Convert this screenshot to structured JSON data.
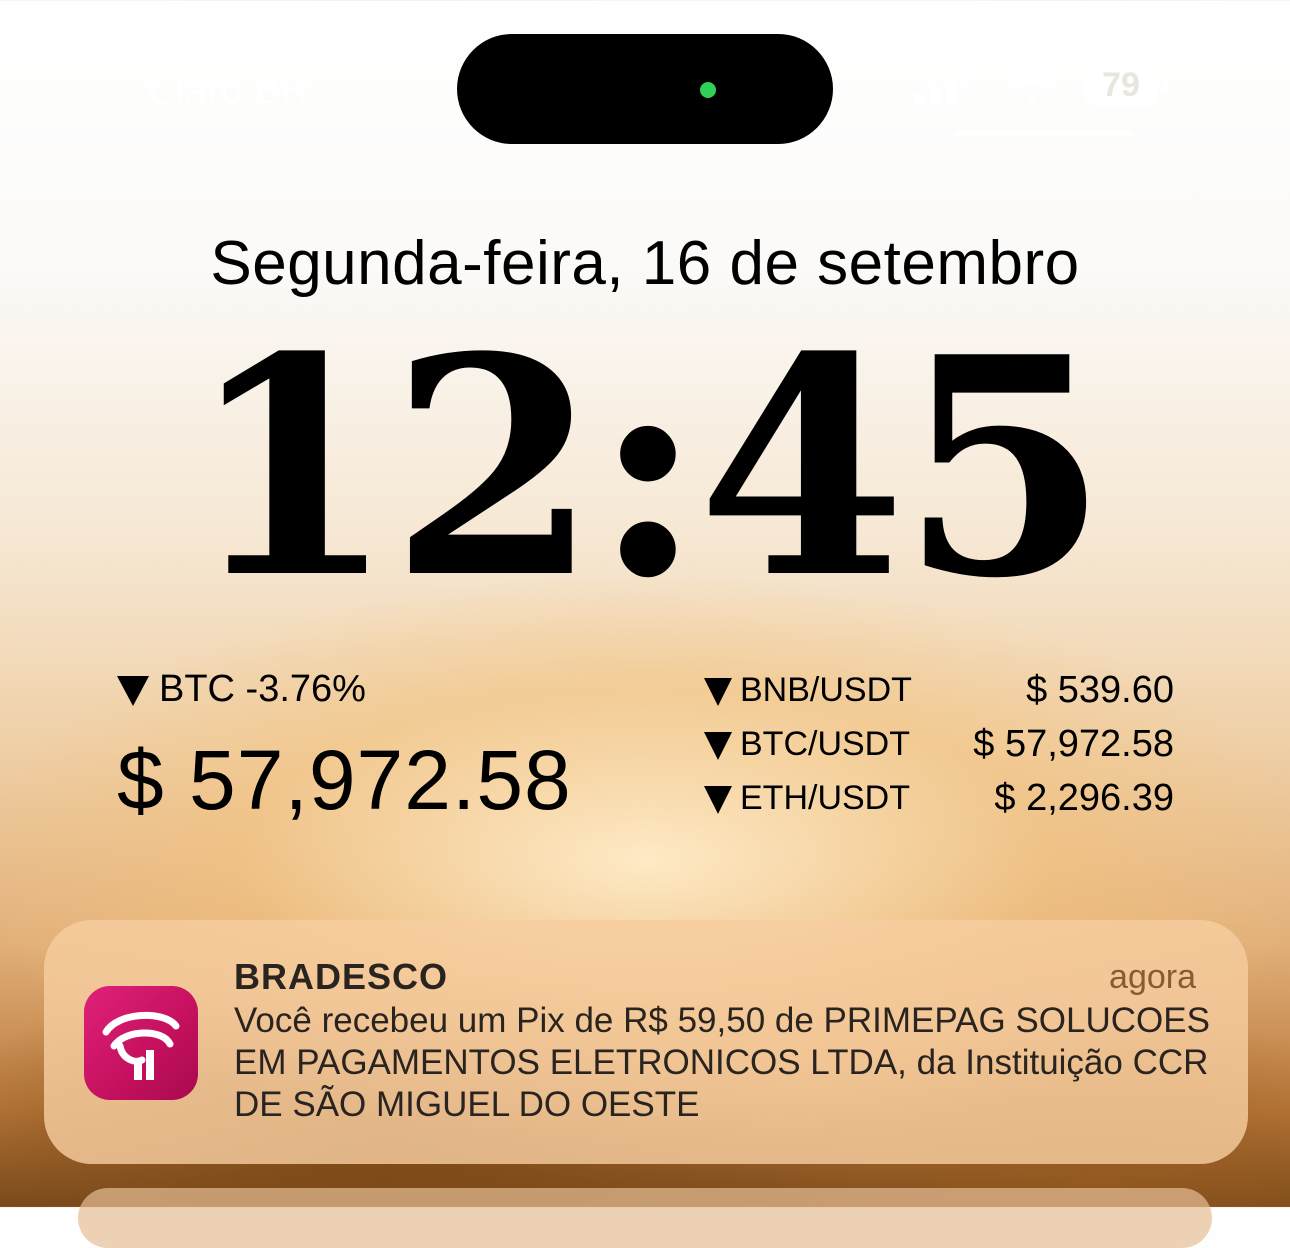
{
  "status_bar": {
    "carrier": "Claro BR",
    "battery_level": "79",
    "island_indicator_color": "#30d158"
  },
  "lock_screen": {
    "date": "Segunda-feira, 16 de setembro",
    "time": "12:45"
  },
  "btc_widget": {
    "direction_icon": "triangle-down-icon",
    "change_label": "BTC -3.76%",
    "price": "$ 57,972.58"
  },
  "pairs_widget": {
    "rows": [
      {
        "name": "BNB/USDT",
        "price": "$ 539.60"
      },
      {
        "name": "BTC/USDT",
        "price": "$ 57,972.58"
      },
      {
        "name": "ETH/USDT",
        "price": "$ 2,296.39"
      }
    ]
  },
  "notification": {
    "app_name": "BRADESCO",
    "time": "agora",
    "body": "Você recebeu um Pix de R$ 59,50 de PRIMEPAG SOLUCOES EM PAGAMENTOS ELETRONICOS LTDA, da Instituição CCR DE SÃO MIGUEL DO OESTE",
    "icon": "bradesco-logo-icon",
    "brand_color": "#cc1166"
  }
}
